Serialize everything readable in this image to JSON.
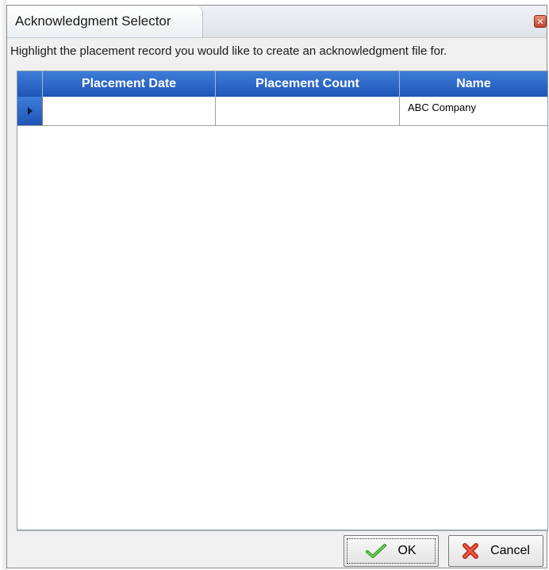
{
  "window": {
    "title": "Acknowledgment Selector",
    "close_symbol": "✕"
  },
  "instruction": "Highlight the placement record you would like to create an acknowledgment file for.",
  "grid": {
    "columns": [
      "Placement Date",
      "Placement Count",
      "Name"
    ],
    "rows": [
      {
        "placement_date": "",
        "placement_count": "",
        "name": "ABC Company"
      }
    ]
  },
  "buttons": {
    "ok_label": "OK",
    "ok_icon": "checkmark-icon",
    "cancel_label": "Cancel",
    "cancel_icon": "red-x-icon"
  },
  "colors": {
    "header_blue": "#2b63c4",
    "ok_green": "#3a9a2a",
    "cancel_red": "#d13a2a"
  }
}
